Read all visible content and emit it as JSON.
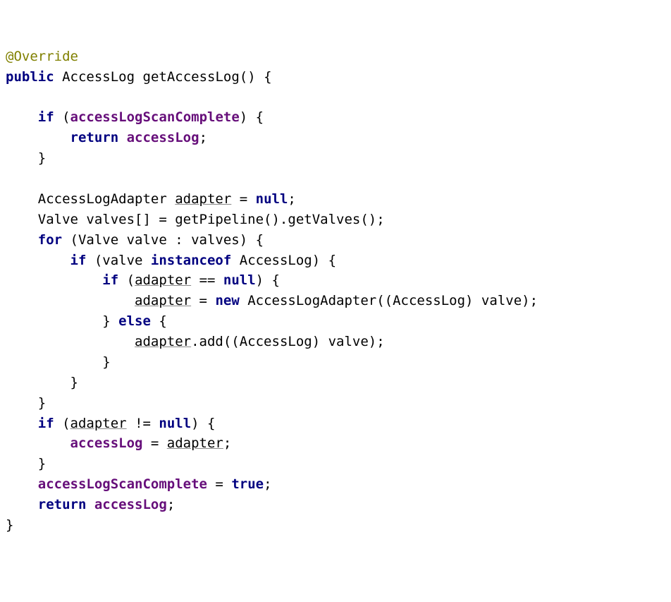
{
  "code": {
    "l01": {
      "ann": "@Override"
    },
    "l02": {
      "kw_public": "public",
      "type": "AccessLog",
      "method": "getAccessLog",
      "paren": "()",
      "brace": " {"
    },
    "l03": {
      "text": ""
    },
    "l04": {
      "kw_if": "if",
      "open": " (",
      "fld": "accessLogScanComplete",
      "close": ") {"
    },
    "l05": {
      "kw_return": "return",
      "sp": " ",
      "fld": "accessLog",
      "semi": ";"
    },
    "l06": {
      "brace": "}"
    },
    "l07": {
      "text": ""
    },
    "l08": {
      "type": "AccessLogAdapter ",
      "var": "adapter",
      "eq": " = ",
      "kw_null": "null",
      "semi": ";"
    },
    "l09": {
      "text": "Valve valves[] = getPipeline().getValves();"
    },
    "l10": {
      "kw_for": "for",
      "open": " (Valve valve : valves) {"
    },
    "l11": {
      "kw_if": "if",
      "open": " (valve ",
      "kw_inst": "instanceof",
      "rest": " AccessLog) {"
    },
    "l12": {
      "kw_if": "if",
      "open": " (",
      "var": "adapter",
      "mid": " == ",
      "kw_null": "null",
      "close": ") {"
    },
    "l13": {
      "var": "adapter",
      "eq": " = ",
      "kw_new": "new",
      "rest": " AccessLogAdapter((AccessLog) valve);"
    },
    "l14": {
      "close_open": "} ",
      "kw_else": "else",
      "brace": " {"
    },
    "l15": {
      "var": "adapter",
      "rest": ".add((AccessLog) valve);"
    },
    "l16": {
      "brace": "}"
    },
    "l17": {
      "brace": "}"
    },
    "l18": {
      "brace": "}"
    },
    "l19": {
      "kw_if": "if",
      "open": " (",
      "var": "adapter",
      "mid": " != ",
      "kw_null": "null",
      "close": ") {"
    },
    "l20": {
      "fld": "accessLog",
      "eq": " = ",
      "var": "adapter",
      "semi": ";"
    },
    "l21": {
      "brace": "}"
    },
    "l22": {
      "fld": "accessLogScanComplete",
      "eq": " = ",
      "kw_true": "true",
      "semi": ";"
    },
    "l23": {
      "kw_return": "return",
      "sp": " ",
      "fld": "accessLog",
      "semi": ";"
    },
    "l24": {
      "brace": "}"
    }
  }
}
